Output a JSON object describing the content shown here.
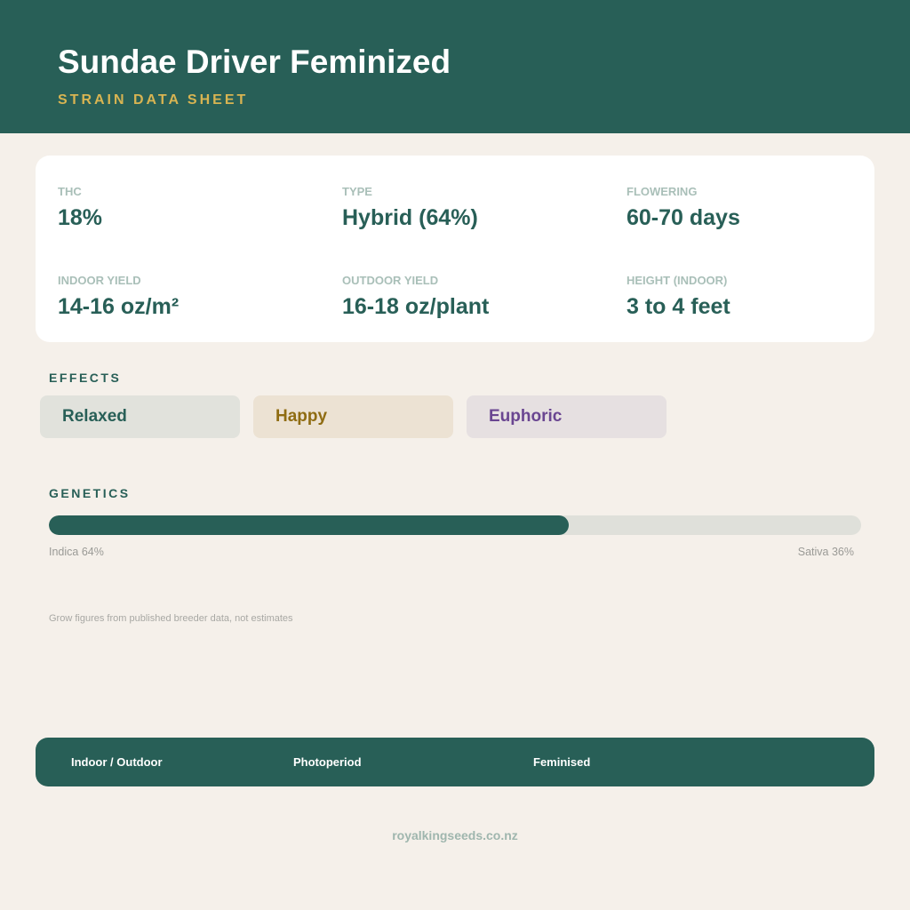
{
  "header": {
    "title": "Sundae Driver Feminized",
    "subtitle": "STRAIN DATA SHEET"
  },
  "stats": [
    {
      "label": "THC",
      "value": "18%"
    },
    {
      "label": "TYPE",
      "value": "Hybrid (64%)"
    },
    {
      "label": "FLOWERING",
      "value": "60-70 days"
    },
    {
      "label": "INDOOR YIELD",
      "value": "14-16 oz/m²"
    },
    {
      "label": "OUTDOOR YIELD",
      "value": "16-18 oz/plant"
    },
    {
      "label": "HEIGHT (INDOOR)",
      "value": "3 to 4 feet"
    }
  ],
  "effects": {
    "label": "EFFECTS",
    "items": [
      "Relaxed",
      "Happy",
      "Euphoric"
    ]
  },
  "genetics": {
    "label": "GENETICS",
    "indica_percent": 64,
    "indica_label": "Indica 64%",
    "sativa_label": "Sativa 36%"
  },
  "note": "Grow figures from published breeder data, not estimates",
  "footer": {
    "items": [
      "Indoor / Outdoor",
      "Photoperiod",
      "Feminised"
    ]
  },
  "website": "royalkingseeds.co.nz",
  "colors": {
    "brand": "#285f57",
    "accent": "#d8b452",
    "background": "#f5f0ea"
  }
}
